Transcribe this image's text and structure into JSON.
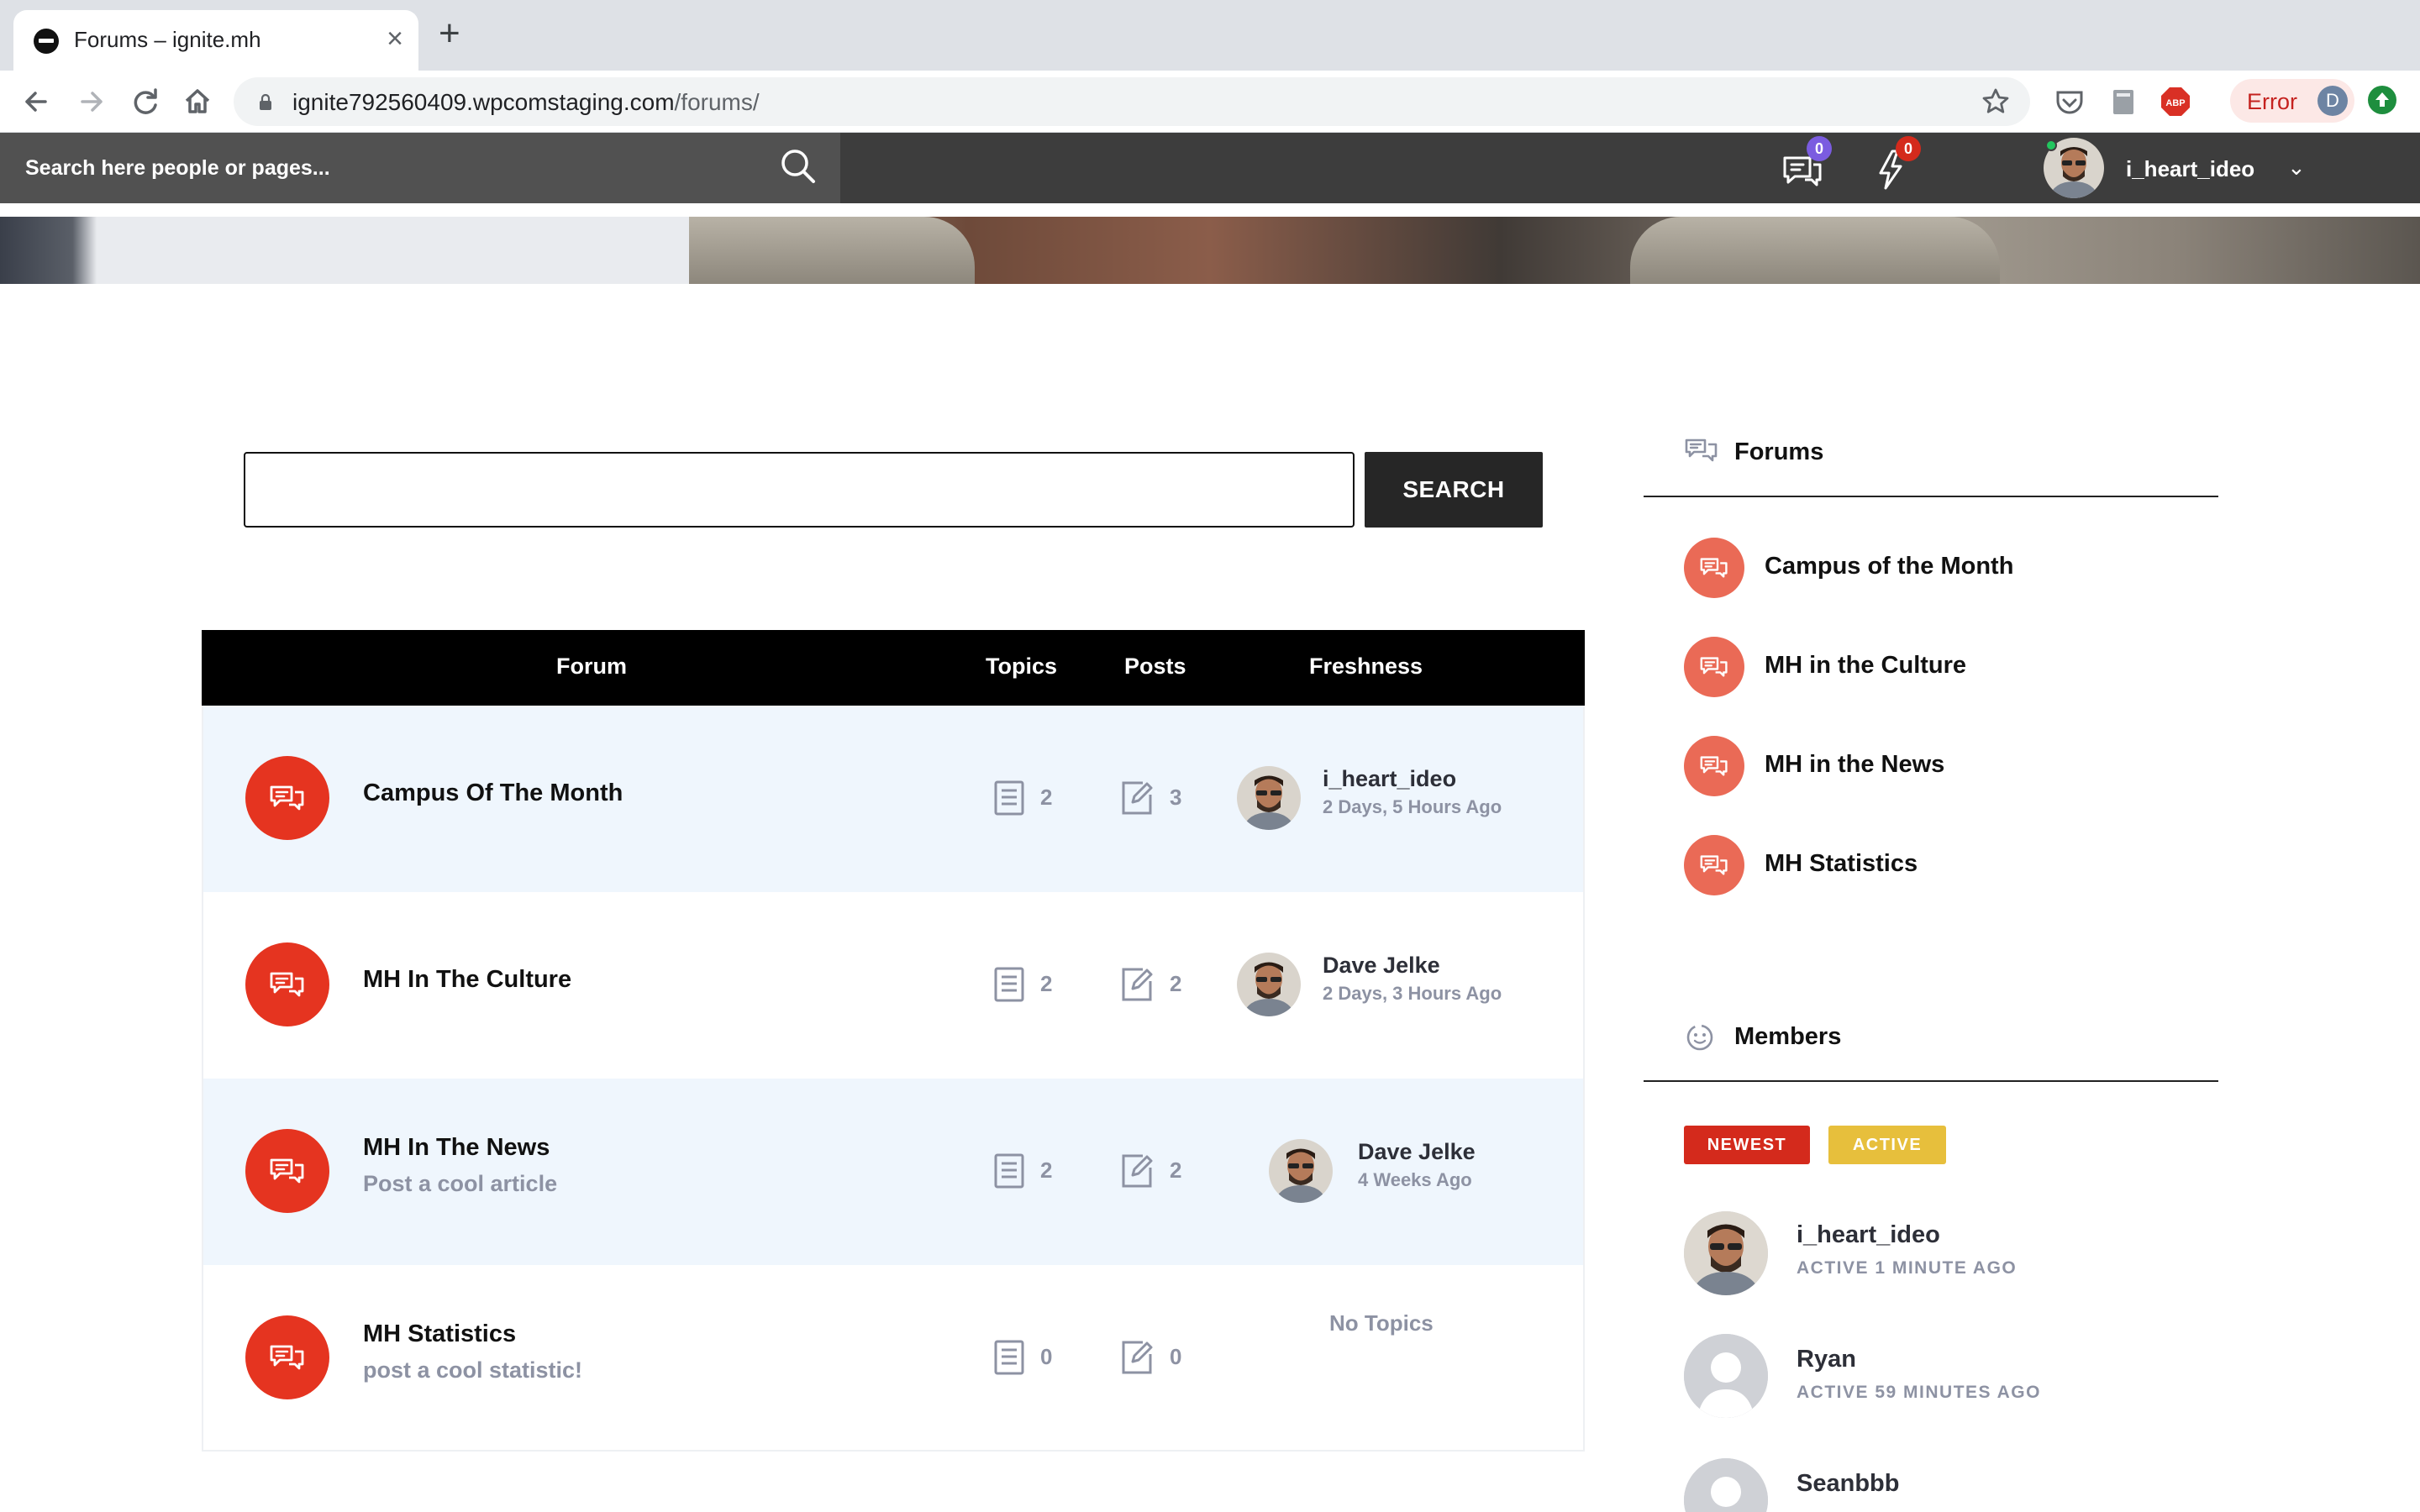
{
  "browser": {
    "tab_title": "Forums – ignite.mh",
    "url_host": "ignite792560409.wpcomstaging.com",
    "url_path": "/forums/",
    "error_label": "Error",
    "profile_initial": "D"
  },
  "site_header": {
    "search_placeholder": "Search here people or pages...",
    "messages_count": "0",
    "notifications_count": "0",
    "username": "i_heart_ideo",
    "caret": "⌄"
  },
  "forum_search": {
    "input_value": "",
    "button_label": "SEARCH"
  },
  "forum_table": {
    "headers": {
      "forum": "Forum",
      "topics": "Topics",
      "posts": "Posts",
      "freshness": "Freshness"
    },
    "rows": [
      {
        "title": "Campus Of The Month",
        "description": "",
        "topics": "2",
        "posts": "3",
        "last_user": "i_heart_ideo",
        "last_time": "2 Days, 5 Hours Ago"
      },
      {
        "title": "MH In The Culture",
        "description": "",
        "topics": "2",
        "posts": "2",
        "last_user": "Dave Jelke",
        "last_time": "2 Days, 3 Hours Ago"
      },
      {
        "title": "MH In The News",
        "description": "Post a cool article",
        "topics": "2",
        "posts": "2",
        "last_user": "Dave Jelke",
        "last_time": "4 Weeks Ago"
      },
      {
        "title": "MH Statistics",
        "description": "post a cool statistic!",
        "topics": "0",
        "posts": "0",
        "no_topics": "No Topics"
      }
    ]
  },
  "sidebar": {
    "forums_widget": {
      "title": "Forums",
      "items": [
        "Campus of the Month",
        "MH in the Culture",
        "MH in the News",
        "MH Statistics"
      ]
    },
    "members_widget": {
      "title": "Members",
      "tabs": [
        "NEWEST",
        "ACTIVE"
      ],
      "members": [
        {
          "name": "i_heart_ideo",
          "status": "ACTIVE 1 MINUTE AGO"
        },
        {
          "name": "Ryan",
          "status": "ACTIVE 59 MINUTES AGO"
        },
        {
          "name": "Seanbbb",
          "status": ""
        }
      ]
    }
  },
  "colors": {
    "forum_icon": "#e53420",
    "sidebar_forum_icon": "#ea6a56",
    "tag_newest": "#d42a1c",
    "tag_active": "#e7bf3c",
    "header_bg": "#3d3d3d",
    "row_alt_bg": "#eff6fd",
    "badge_messages": "#7b5ce0",
    "badge_notifications": "#d42a1c"
  },
  "icons": {
    "forum_icon": "chat-bubbles-icon",
    "topics_icon": "document-list-icon",
    "posts_icon": "edit-note-icon",
    "members_icon": "smiley-icon"
  }
}
